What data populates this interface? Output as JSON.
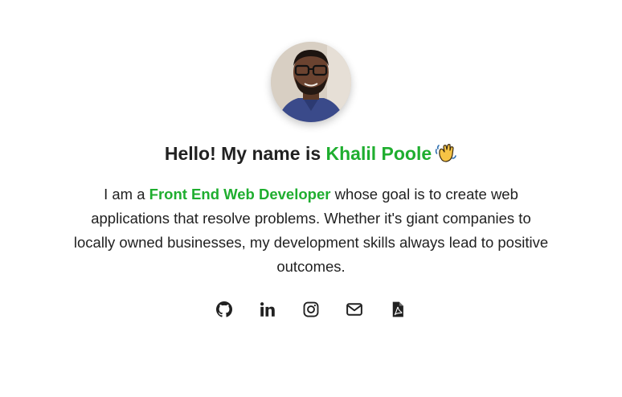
{
  "colors": {
    "accent": "#1fae2f",
    "text": "#212121"
  },
  "hero": {
    "avatar_icon": "profile-photo",
    "greeting_prefix": "Hello! My name is ",
    "name": "Khalil Poole",
    "wave_icon": "waving-hand-emoji",
    "bio_prefix": "I am a ",
    "bio_role": "Front End Web Developer",
    "bio_rest": " whose goal is to create web applications that resolve problems. Whether it's giant companies to locally owned businesses, my development skills always lead to positive outcomes."
  },
  "socials": [
    {
      "icon": "github-icon"
    },
    {
      "icon": "linkedin-icon"
    },
    {
      "icon": "instagram-icon"
    },
    {
      "icon": "mail-icon"
    },
    {
      "icon": "pdf-resume-icon"
    }
  ]
}
